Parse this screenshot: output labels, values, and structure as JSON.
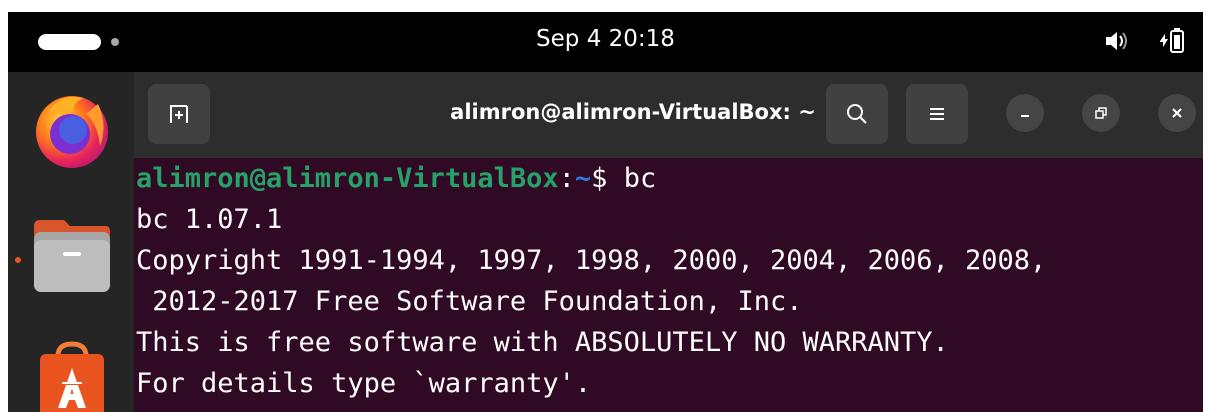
{
  "top_panel": {
    "clock": "Sep 4  20:18",
    "icons": [
      "activities-indicator",
      "volume-icon",
      "battery-icon"
    ]
  },
  "dock": {
    "apps": [
      {
        "name": "Firefox",
        "icon": "firefox-icon"
      },
      {
        "name": "Files",
        "icon": "files-icon",
        "running": true
      },
      {
        "name": "App Center",
        "icon": "app-center-icon"
      }
    ]
  },
  "window": {
    "title": "alimron@alimron-VirtualBox: ~",
    "header_icons": [
      "new-tab-icon",
      "search-icon",
      "menu-icon",
      "minimize-icon",
      "restore-icon",
      "close-icon"
    ],
    "colors": {
      "background": "#300a24",
      "prompt_user": "#26a269",
      "prompt_path": "#2a7bde",
      "headerbar": "#2d2d2d"
    }
  },
  "terminal": {
    "prompt_user_host": "alimron@alimron-VirtualBox",
    "prompt_separator": ":",
    "prompt_path": "~",
    "prompt_symbol": "$ ",
    "command": "bc",
    "output": [
      "bc 1.07.1",
      "Copyright 1991-1994, 1997, 1998, 2000, 2004, 2006, 2008,",
      " 2012-2017 Free Software Foundation, Inc.",
      "This is free software with ABSOLUTELY NO WARRANTY.",
      "For details type `warranty'."
    ]
  }
}
